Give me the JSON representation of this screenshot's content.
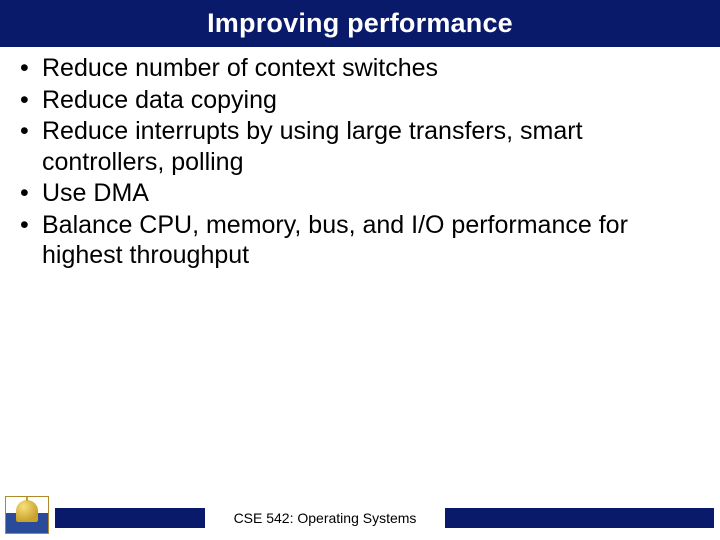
{
  "slide": {
    "title": "Improving performance",
    "bullets": [
      "Reduce number of context switches",
      "Reduce data copying",
      "Reduce interrupts by using large transfers, smart controllers, polling",
      "Use DMA",
      "Balance CPU, memory, bus, and I/O performance for highest throughput"
    ],
    "footer": "CSE 542: Operating Systems"
  },
  "colors": {
    "brand": "#0a1a6b"
  }
}
